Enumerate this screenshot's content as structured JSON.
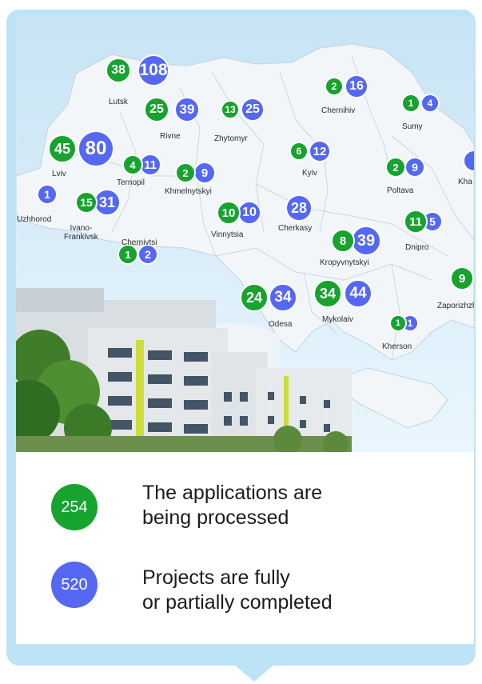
{
  "colors": {
    "processing": "#16a32e",
    "completed": "#5468f3",
    "frame": "#bde4f6"
  },
  "regions": [
    {
      "name": "Lutsk",
      "processing": "38",
      "completed": "108"
    },
    {
      "name": "Rivne",
      "processing": "25",
      "completed": "39"
    },
    {
      "name": "Zhytomyr",
      "processing": "13",
      "completed": "25"
    },
    {
      "name": "Chernihiv",
      "processing": "2",
      "completed": "16"
    },
    {
      "name": "Sumy",
      "processing": "1",
      "completed": "4"
    },
    {
      "name": "Lviv",
      "processing": "45",
      "completed": "80"
    },
    {
      "name": "Ternopil",
      "processing": "4",
      "completed": "11"
    },
    {
      "name": "Khmelnytskyi",
      "processing": "2",
      "completed": "9"
    },
    {
      "name": "Kyiv",
      "processing": "6",
      "completed": "12"
    },
    {
      "name": "Poltava",
      "processing": "2",
      "completed": "9"
    },
    {
      "name": "Kha",
      "processing": "",
      "completed": ""
    },
    {
      "name": "Uzhhorod",
      "processing": "",
      "completed": "1"
    },
    {
      "name": "Ivano-\nFrankivsk",
      "processing": "15",
      "completed": "31"
    },
    {
      "name": "Chernivtsi",
      "processing": "1",
      "completed": "2"
    },
    {
      "name": "Vinnytsia",
      "processing": "10",
      "completed": "10"
    },
    {
      "name": "Cherkasy",
      "processing": "",
      "completed": "28"
    },
    {
      "name": "Kropyvnytskyi",
      "processing": "8",
      "completed": "39"
    },
    {
      "name": "Dnipro",
      "processing": "11",
      "completed": "5"
    },
    {
      "name": "Zaporizhzh",
      "processing": "9",
      "completed": ""
    },
    {
      "name": "Odesa",
      "processing": "24",
      "completed": "34"
    },
    {
      "name": "Mykolaiv",
      "processing": "34",
      "completed": "44"
    },
    {
      "name": "Kherson",
      "processing": "1",
      "completed": "1"
    }
  ],
  "legend": {
    "processing_total": "254",
    "processing_text": "The applications are\nbeing processed",
    "completed_total": "520",
    "completed_text": "Projects are fully\nor partially completed"
  }
}
